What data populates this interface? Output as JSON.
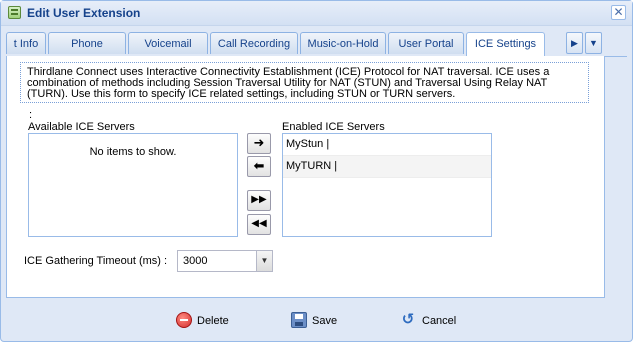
{
  "window": {
    "title": "Edit User Extension"
  },
  "tabs": [
    {
      "label": "t Info"
    },
    {
      "label": "Phone"
    },
    {
      "label": "Voicemail"
    },
    {
      "label": "Call Recording"
    },
    {
      "label": "Music-on-Hold"
    },
    {
      "label": "User Portal"
    },
    {
      "label": "ICE Settings",
      "active": true
    }
  ],
  "info_text": "Thirdlane Connect uses Interactive Connectivity Establishment (ICE) Protocol for NAT traversal. ICE uses a combination of methods including Session Traversal Utility for NAT (STUN) and Traversal Using Relay NAT (TURN). Use this form to specify ICE related settings, including STUN or TURN servers.",
  "colon_label": ":",
  "available": {
    "label": "Available ICE Servers",
    "empty_text": "No items to show."
  },
  "enabled": {
    "label": "Enabled ICE Servers",
    "items": [
      "MyStun |",
      "MyTURN |"
    ]
  },
  "timeout": {
    "label": "ICE Gathering Timeout (ms) :",
    "value": "3000"
  },
  "footer": {
    "delete_label": "Delete",
    "save_label": "Save",
    "cancel_label": "Cancel"
  }
}
